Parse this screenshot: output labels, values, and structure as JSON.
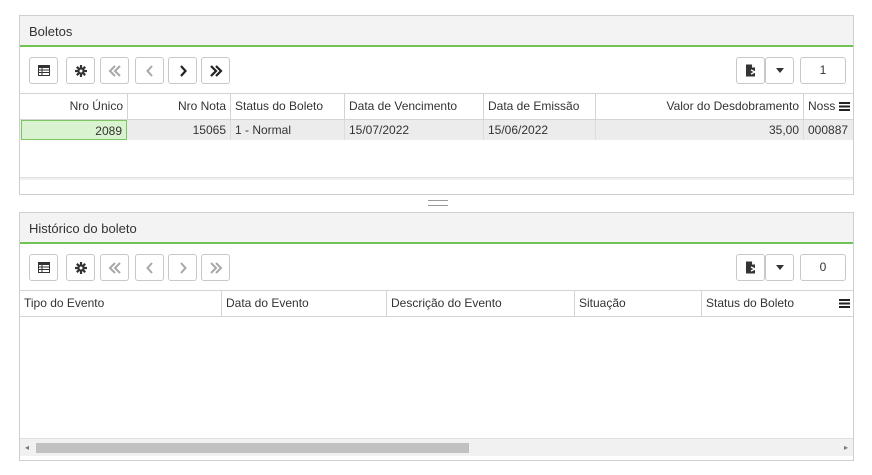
{
  "boletos": {
    "title": "Boletos",
    "page_number": "1",
    "columns": [
      "Nro Único",
      "Nro Nota",
      "Status do Boleto",
      "Data de Vencimento",
      "Data de Emissão",
      "Valor do Desdobramento",
      "Noss"
    ],
    "rows": [
      [
        "2089",
        "15065",
        "1 - Normal",
        "15/07/2022",
        "15/06/2022",
        "35,00",
        "000887"
      ]
    ]
  },
  "historico": {
    "title": "Histórico do boleto",
    "page_number": "0",
    "columns": [
      "Tipo do Evento",
      "Data do Evento",
      "Descrição do Evento",
      "Situação",
      "Status do Boleto"
    ]
  },
  "icons": {
    "grid": "table-view-icon",
    "config": "gear-icon",
    "first": "double-chevron-left-icon",
    "prev": "chevron-left-icon",
    "next": "chevron-right-icon",
    "last": "double-chevron-right-icon",
    "export": "export-file-icon",
    "dropdown": "caret-down-icon",
    "columns_menu": "hamburger-menu-icon"
  },
  "colors": {
    "accent": "#6fc256",
    "selected_cell_bg": "#d9f2d0"
  }
}
